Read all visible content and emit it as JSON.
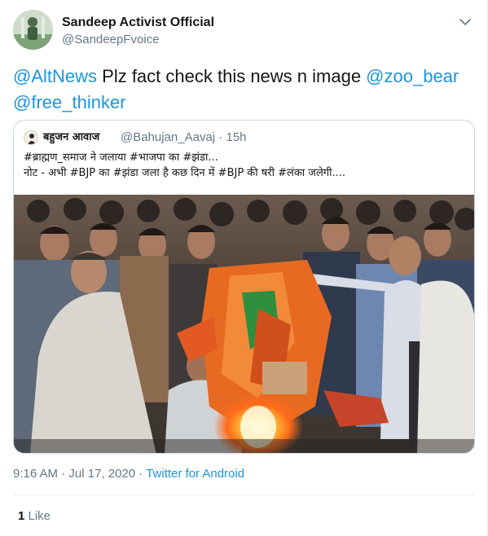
{
  "author": {
    "display_name": "Sandeep Activist Official",
    "handle": "@SandeepFvoice"
  },
  "tweet_text": {
    "mention_1": "@AltNews",
    "text_1": " Plz fact check this news n image ",
    "mention_2": "@zoo_bear",
    "mention_3": "@free_thinker"
  },
  "quoted_tweet": {
    "author_name": "बहुजन आवाज",
    "handle": "@Bahujan_Aavaj",
    "separator": " · ",
    "time": "15h",
    "line_1": "#ब्राह्मण_समाज ने जलाया #भाजपा का #झंडा...",
    "line_2": " नोट - अभी #BJP का #झंडा जला है कछ दिन में #BJP की षरी #लंका जलेगी...."
  },
  "meta": {
    "time": "9:16 AM",
    "separator_1": " · ",
    "date": "Jul 17, 2020",
    "separator_2": " · ",
    "source": "Twitter for Android"
  },
  "stats": {
    "like_count": "1",
    "like_label": " Like"
  },
  "colors": {
    "link": "#1b95e0",
    "secondary_text": "#657786",
    "border": "#ccd6dd"
  },
  "icons": {
    "menu": "chevron-down-icon"
  }
}
